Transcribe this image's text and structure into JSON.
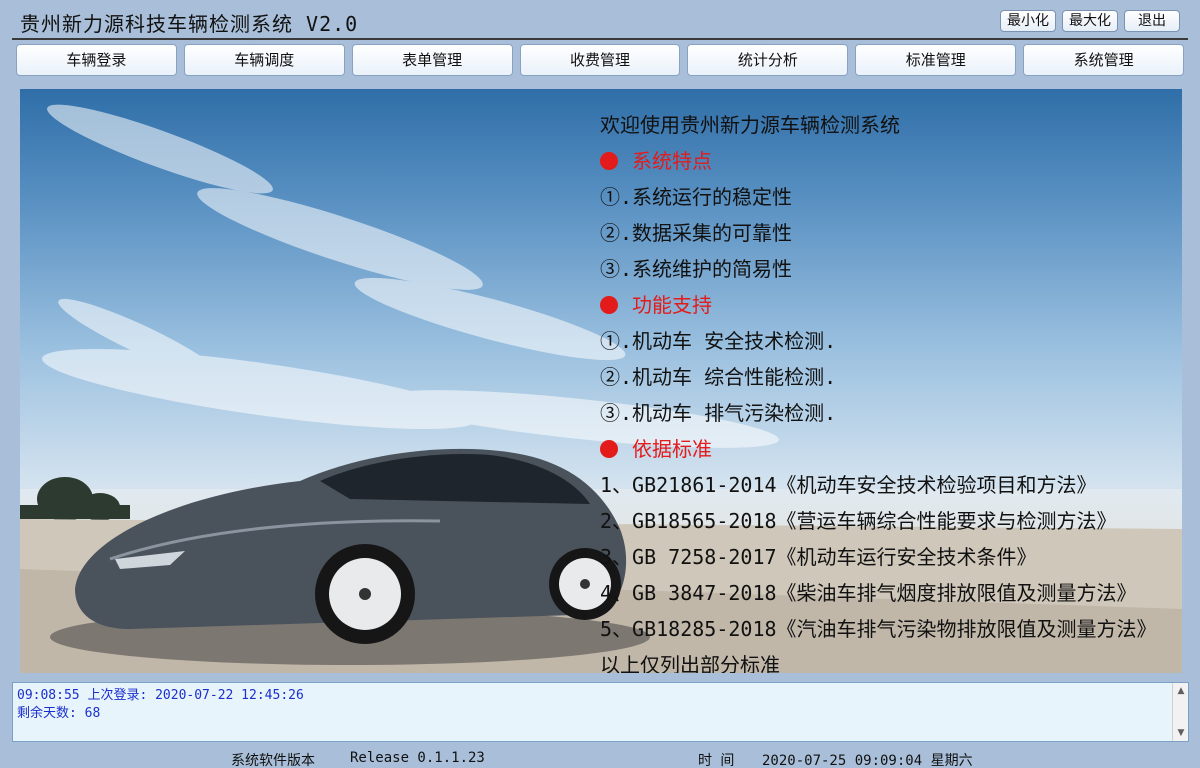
{
  "window": {
    "title": "贵州新力源科技车辆检测系统 V2.0",
    "buttons": {
      "minimize": "最小化",
      "maximize": "最大化",
      "exit": "退出"
    }
  },
  "menu": [
    "车辆登录",
    "车辆调度",
    "表单管理",
    "收费管理",
    "统计分析",
    "标准管理",
    "系统管理"
  ],
  "banner": {
    "lines": [
      {
        "text": "欢迎使用贵州新力源车辆检测系统",
        "style": "normal"
      },
      {
        "text": "系统特点",
        "style": "heading"
      },
      {
        "text": "①.系统运行的稳定性",
        "style": "normal"
      },
      {
        "text": "②.数据采集的可靠性",
        "style": "normal"
      },
      {
        "text": "③.系统维护的简易性",
        "style": "normal"
      },
      {
        "text": "功能支持",
        "style": "heading"
      },
      {
        "text": "①.机动车 安全技术检测.",
        "style": "normal"
      },
      {
        "text": "②.机动车 综合性能检测.",
        "style": "normal"
      },
      {
        "text": "③.机动车 排气污染检测.",
        "style": "normal"
      },
      {
        "text": "依据标准",
        "style": "heading"
      },
      {
        "text": "1、GB21861-2014《机动车安全技术检验项目和方法》",
        "style": "normal"
      },
      {
        "text": "2、GB18565-2018《营运车辆综合性能要求与检测方法》",
        "style": "normal"
      },
      {
        "text": "3、GB 7258-2017《机动车运行安全技术条件》",
        "style": "normal"
      },
      {
        "text": "4、GB 3847-2018《柴油车排气烟度排放限值及测量方法》",
        "style": "normal"
      },
      {
        "text": "5、GB18285-2018《汽油车排气污染物排放限值及测量方法》",
        "style": "normal"
      },
      {
        "text": "以上仅列出部分标准",
        "style": "normal"
      }
    ]
  },
  "log": {
    "lines": [
      "09:08:55  上次登录: 2020-07-22 12:45:26",
      "剩余天数: 68"
    ]
  },
  "status": {
    "version_label": "系统软件版本",
    "version_value": "Release 0.1.1.23",
    "time_label": "时 间",
    "time_value": "2020-07-25 09:09:04 星期六"
  },
  "colors": {
    "background": "#a9bfd9",
    "heading": "#e31b1b",
    "log_text": "#1b2fcf"
  }
}
